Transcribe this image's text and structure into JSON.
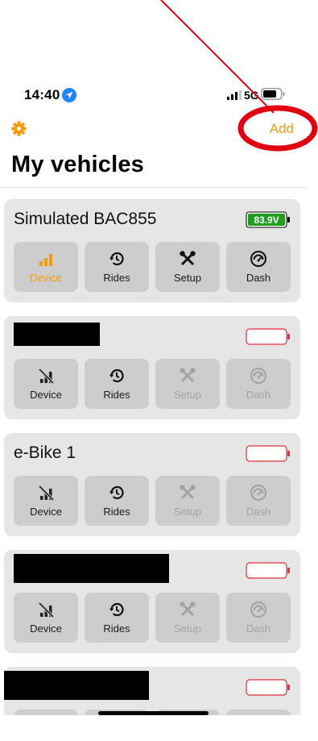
{
  "colors": {
    "accent": "#f59a0c",
    "battery_ok": "#1f9d1f",
    "battery_empty": "#e0303b",
    "annotation": "#e0000f"
  },
  "status_bar": {
    "time": "14:40",
    "network": "5G"
  },
  "header": {
    "add_label": "Add",
    "title": "My vehicles",
    "settings_icon": "gear-icon"
  },
  "vehicles": [
    {
      "name": "Simulated BAC855",
      "battery_text": "83.9V",
      "battery_state": "full",
      "buttons": {
        "device": "Device",
        "rides": "Rides",
        "setup": "Setup",
        "dash": "Dash"
      }
    },
    {
      "name": "",
      "battery_state": "empty",
      "buttons": {
        "device": "Device",
        "rides": "Rides",
        "setup": "Setup",
        "dash": "Dash"
      }
    },
    {
      "name": "e-Bike 1",
      "battery_state": "empty",
      "buttons": {
        "device": "Device",
        "rides": "Rides",
        "setup": "Setup",
        "dash": "Dash"
      }
    },
    {
      "name": "",
      "battery_state": "empty",
      "buttons": {
        "device": "Device",
        "rides": "Rides",
        "setup": "Setup",
        "dash": "Dash"
      }
    },
    {
      "name": "",
      "battery_state": "empty"
    }
  ]
}
